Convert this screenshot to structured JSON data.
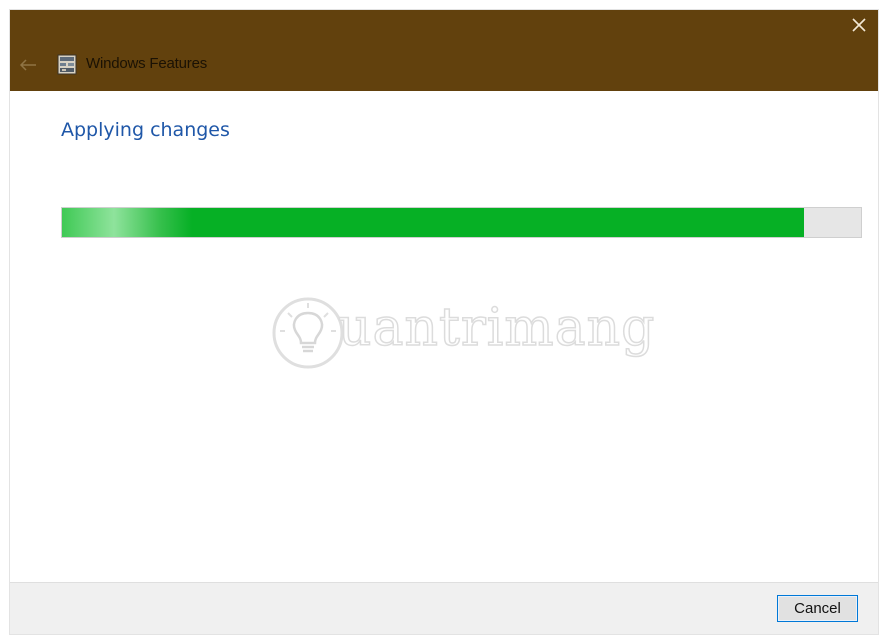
{
  "window": {
    "title": "Windows Features",
    "titlebar_color": "#62410d",
    "close_icon": "close-icon",
    "back_icon": "back-arrow-icon",
    "app_icon": "windows-features-icon"
  },
  "main": {
    "heading": "Applying changes",
    "heading_color": "#1f57a8",
    "progress": {
      "fraction": 0.929,
      "color": "#06b025"
    }
  },
  "watermark": {
    "text": "uantrimang",
    "icon": "lightbulb-icon"
  },
  "footer": {
    "cancel_label": "Cancel"
  }
}
